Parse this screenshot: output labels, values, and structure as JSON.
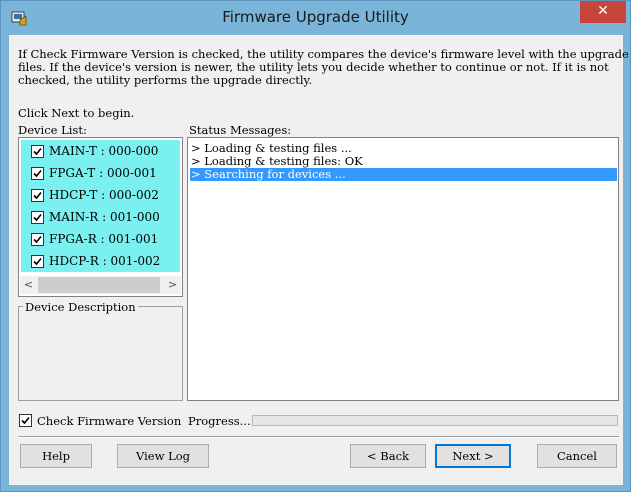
{
  "window": {
    "title": "Firmware Upgrade Utility",
    "close_label": "✕"
  },
  "intro": {
    "lines": [
      "If Check Firmware Version is checked, the utility compares the device's firmware level with the upgrade",
      "files. If the device's version is newer, the utility lets you decide whether to continue or not. If it is not",
      "checked, the utility performs the upgrade directly."
    ],
    "begin": "Click Next to begin."
  },
  "device_list": {
    "label": "Device List:",
    "items": [
      {
        "label": "MAIN-T : 000-000",
        "checked": true
      },
      {
        "label": "FPGA-T : 000-001",
        "checked": true
      },
      {
        "label": "HDCP-T : 000-002",
        "checked": true
      },
      {
        "label": "MAIN-R : 001-000",
        "checked": true
      },
      {
        "label": "FPGA-R : 001-001",
        "checked": true
      },
      {
        "label": "HDCP-R : 001-002",
        "checked": true
      }
    ],
    "highlight_color": "#7af0f0",
    "scroll_left": "<",
    "scroll_right": ">"
  },
  "device_description": {
    "label": "Device Description"
  },
  "status": {
    "label": "Status Messages:",
    "messages": [
      "> Loading & testing files ...",
      "> Loading & testing files: OK",
      "> Searching for devices ..."
    ],
    "selected_index": 2,
    "selected_color": "#3399ff"
  },
  "options": {
    "check_firmware_label": "Check Firmware Version",
    "check_firmware_checked": true,
    "progress_label": "Progress...",
    "progress_fraction": 0.0
  },
  "buttons": {
    "help": "Help",
    "view_log": "View Log",
    "back": "< Back",
    "next": "Next >",
    "cancel": "Cancel"
  }
}
